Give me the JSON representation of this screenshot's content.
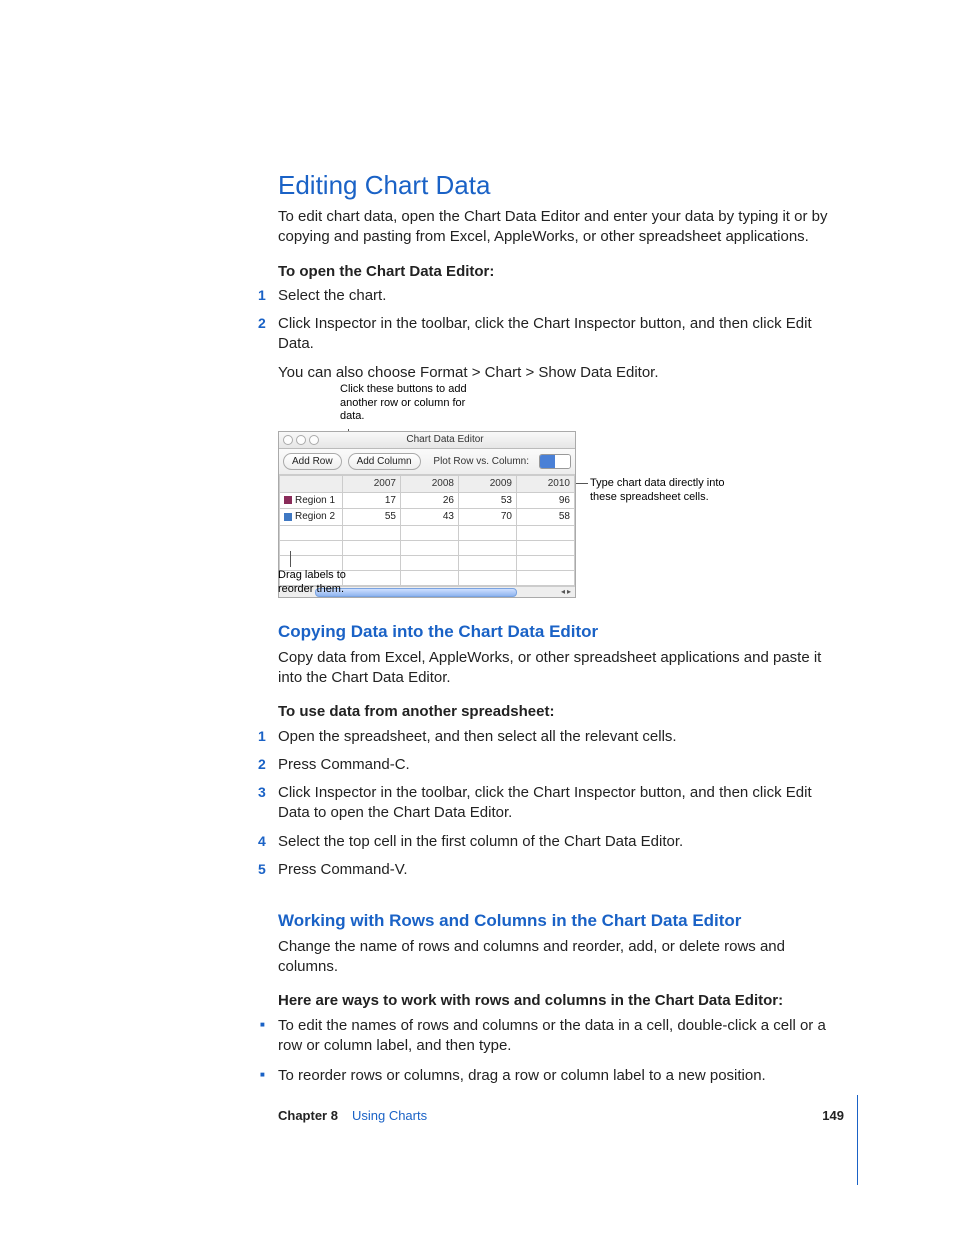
{
  "title": "Editing Chart Data",
  "intro": "To edit chart data, open the Chart Data Editor and enter your data by typing it or by copying and pasting from Excel, AppleWorks, or other spreadsheet applications.",
  "proc1": {
    "lead": "To open the Chart Data Editor:",
    "steps": [
      "Select the chart.",
      "Click Inspector in the toolbar, click the Chart Inspector button, and then click Edit Data."
    ],
    "note": "You can also choose Format > Chart > Show Data Editor."
  },
  "diagram": {
    "callout_top": "Click these buttons to add another row or column for data.",
    "callout_right": "Type chart data directly into these spreadsheet cells.",
    "callout_bottom": "Drag labels to reorder them.",
    "window_title": "Chart Data Editor",
    "btn_add_row": "Add Row",
    "btn_add_col": "Add Column",
    "plot_label": "Plot Row vs. Column:",
    "headers": [
      "",
      "2007",
      "2008",
      "2009",
      "2010"
    ],
    "rows": [
      {
        "label": "Region 1",
        "vals": [
          "17",
          "26",
          "53",
          "96"
        ]
      },
      {
        "label": "Region 2",
        "vals": [
          "55",
          "43",
          "70",
          "58"
        ]
      }
    ]
  },
  "sub1": {
    "title": "Copying Data into the Chart Data Editor",
    "intro": "Copy data from Excel, AppleWorks, or other spreadsheet applications and paste it into the Chart Data Editor.",
    "lead": "To use data from another spreadsheet:",
    "steps": [
      "Open the spreadsheet, and then select all the relevant cells.",
      "Press Command-C.",
      "Click Inspector in the toolbar, click the Chart Inspector button, and then click Edit Data to open the Chart Data Editor.",
      "Select the top cell in the first column of the Chart Data Editor.",
      "Press Command-V."
    ]
  },
  "sub2": {
    "title": "Working with Rows and Columns in the Chart Data Editor",
    "intro": "Change the name of rows and columns and reorder, add, or delete rows and columns.",
    "lead": "Here are ways to work with rows and columns in the Chart Data Editor:",
    "bullets": [
      "To edit the names of rows and columns or the data in a cell, double-click a cell or a row or column label, and then type.",
      "To reorder rows or columns, drag a row or column label to a new position."
    ]
  },
  "footer": {
    "chapter_label": "Chapter 8",
    "chapter_name": "Using Charts",
    "page": "149"
  }
}
